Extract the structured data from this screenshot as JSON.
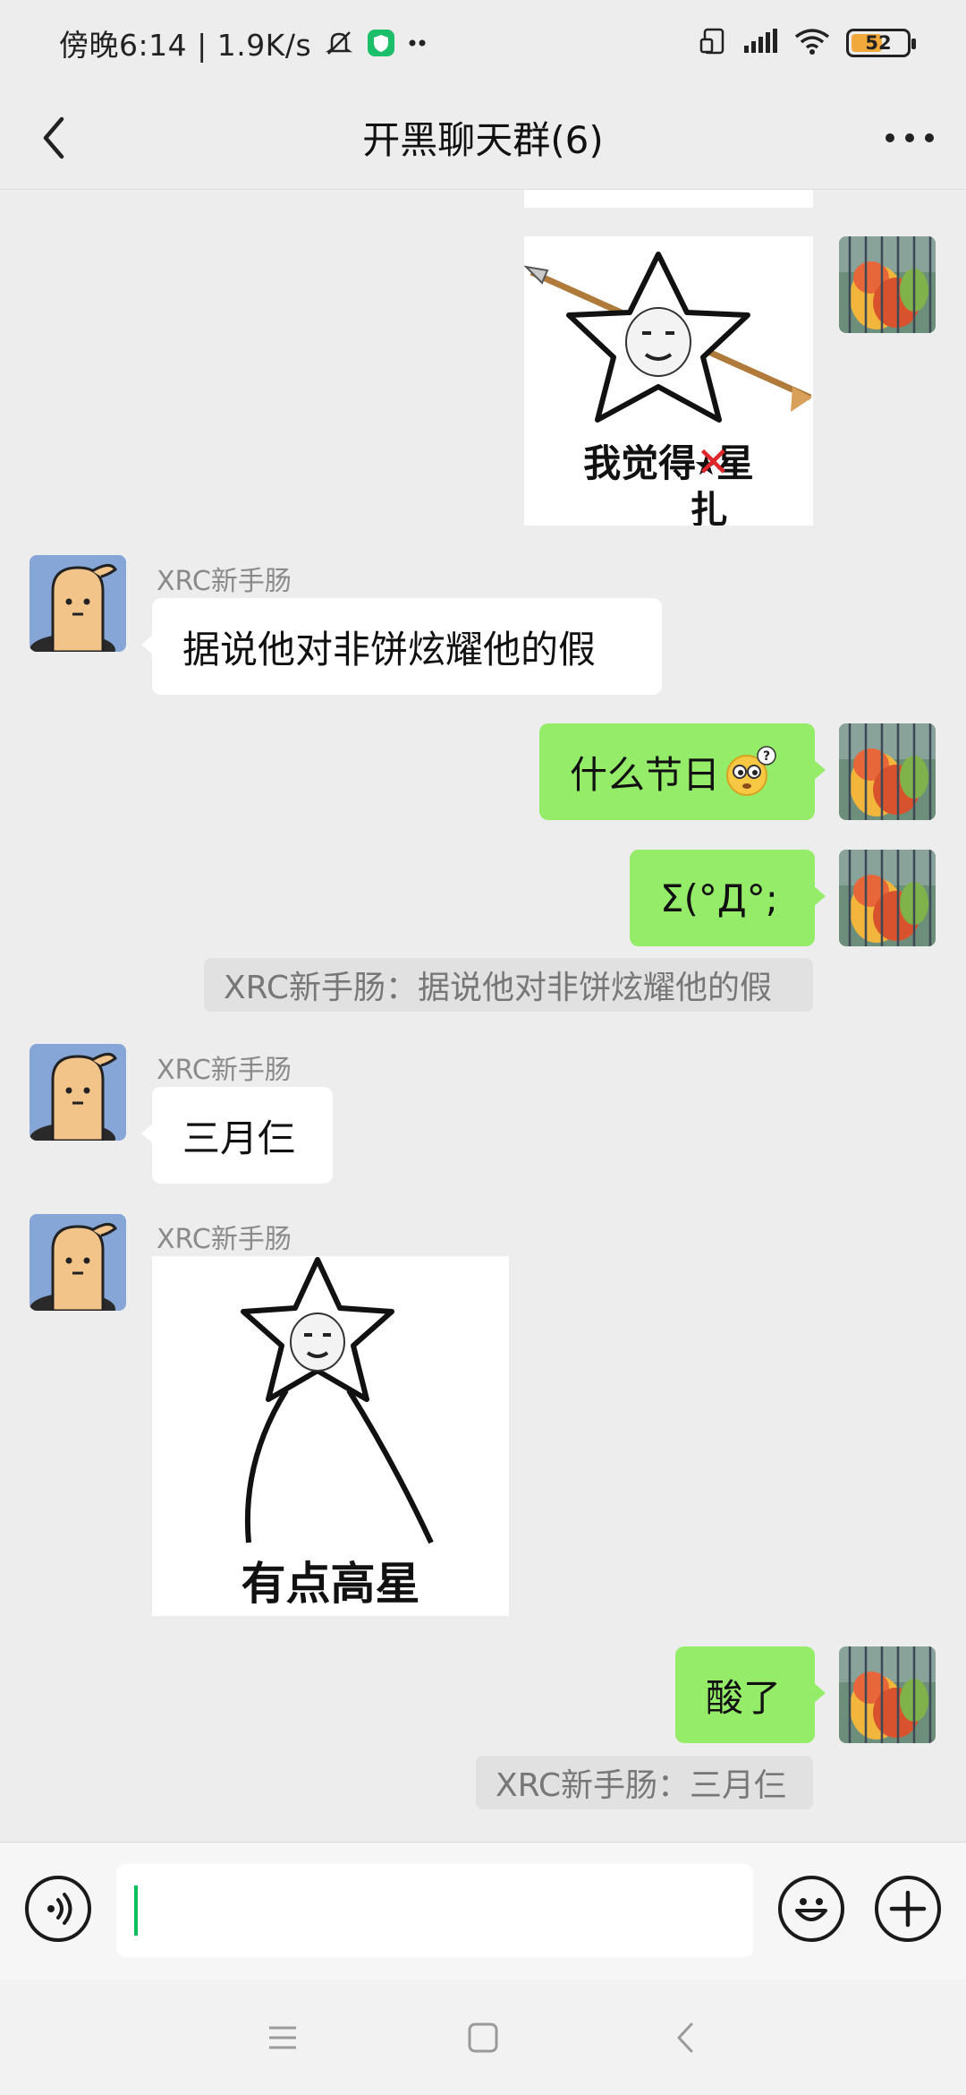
{
  "status_bar": {
    "time_speed": "傍晚6:14 | 1.9K/s",
    "battery_level": "52",
    "icons": [
      "bell-muted-icon",
      "shield-app-icon",
      "dots-icon",
      "screen-rotate-icon",
      "signal-icon",
      "wifi-icon",
      "battery-icon"
    ]
  },
  "header": {
    "title": "开黑聊天群(6)",
    "back_icon": "chevron-left-icon",
    "more_icon": "more-dots-icon"
  },
  "colors": {
    "background": "#ededed",
    "bubble_out": "#95ec69",
    "bubble_in": "#ffffff",
    "quote_bg": "#e1e1e1",
    "caret": "#07c160",
    "battery_fill": "#f0a93a"
  },
  "messages": [
    {
      "type": "sticker",
      "direction": "out",
      "caption_line1": "我觉得",
      "caption_cross": "扎",
      "caption_rest": "星",
      "caption_line2": "扎"
    },
    {
      "type": "text",
      "direction": "in",
      "sender": "XRC新手肠",
      "text": "据说他对非饼炫耀他的假"
    },
    {
      "type": "text",
      "direction": "out",
      "text": "什么节日",
      "emoji": "thinking-face-icon"
    },
    {
      "type": "text",
      "direction": "out",
      "text": "Σ(°Д°;"
    },
    {
      "type": "quote",
      "text": "XRC新手肠：据说他对非饼炫耀他的假"
    },
    {
      "type": "text",
      "direction": "in",
      "sender": "XRC新手肠",
      "text": "三月仨"
    },
    {
      "type": "sticker",
      "direction": "in",
      "sender": "XRC新手肠",
      "caption": "有点高星"
    },
    {
      "type": "text",
      "direction": "out",
      "text": "酸了"
    },
    {
      "type": "quote",
      "text": "XRC新手肠：三月仨"
    }
  ],
  "input_bar": {
    "value": "",
    "voice_icon": "voice-icon",
    "emoji_icon": "emoji-icon",
    "add_icon": "plus-icon"
  },
  "nav_bar": {
    "icons": [
      "menu-icon",
      "home-square-icon",
      "back-chevron-icon"
    ]
  }
}
